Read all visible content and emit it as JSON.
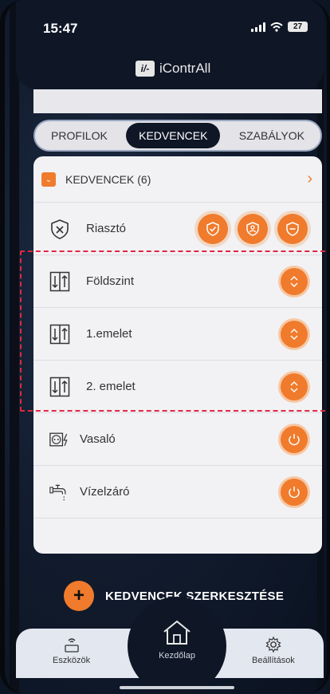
{
  "status_bar": {
    "time": "15:47",
    "battery": "27"
  },
  "app": {
    "logo_mark": "i/-",
    "title": "iContrAll"
  },
  "tabs": [
    {
      "label": "PROFILOK",
      "active": false
    },
    {
      "label": "KEDVENCEK",
      "active": true
    },
    {
      "label": "SZABÁLYOK",
      "active": false
    }
  ],
  "favorites": {
    "title": "KEDVENCEK (6)",
    "items": [
      {
        "label": "Riasztó",
        "icon": "shield-x-icon"
      },
      {
        "label": "Földszint",
        "icon": "blinds-up-down-icon"
      },
      {
        "label": "1.emelet",
        "icon": "blinds-up-down-icon"
      },
      {
        "label": "2. emelet",
        "icon": "blinds-up-down-icon"
      },
      {
        "label": "Vasaló",
        "icon": "socket-power-icon"
      },
      {
        "label": "Vízelzáró",
        "icon": "water-tap-icon"
      }
    ]
  },
  "edit_button": {
    "label": "KEDVENCEK SZERKESZTÉSE"
  },
  "bottom_nav": {
    "devices": "Eszközök",
    "home": "Kezdőlap",
    "settings": "Beállítások"
  },
  "colors": {
    "accent": "#f07b2c",
    "dark": "#0f1726",
    "highlight": "#e22740"
  }
}
